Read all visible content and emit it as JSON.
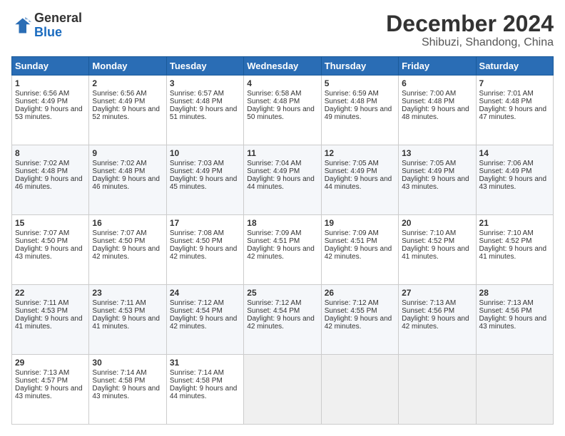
{
  "logo": {
    "general": "General",
    "blue": "Blue"
  },
  "header": {
    "month": "December 2024",
    "location": "Shibuzi, Shandong, China"
  },
  "weekdays": [
    "Sunday",
    "Monday",
    "Tuesday",
    "Wednesday",
    "Thursday",
    "Friday",
    "Saturday"
  ],
  "weeks": [
    [
      {
        "day": "1",
        "sunrise": "6:56 AM",
        "sunset": "4:49 PM",
        "daylight": "9 hours and 53 minutes."
      },
      {
        "day": "2",
        "sunrise": "6:56 AM",
        "sunset": "4:49 PM",
        "daylight": "9 hours and 52 minutes."
      },
      {
        "day": "3",
        "sunrise": "6:57 AM",
        "sunset": "4:48 PM",
        "daylight": "9 hours and 51 minutes."
      },
      {
        "day": "4",
        "sunrise": "6:58 AM",
        "sunset": "4:48 PM",
        "daylight": "9 hours and 50 minutes."
      },
      {
        "day": "5",
        "sunrise": "6:59 AM",
        "sunset": "4:48 PM",
        "daylight": "9 hours and 49 minutes."
      },
      {
        "day": "6",
        "sunrise": "7:00 AM",
        "sunset": "4:48 PM",
        "daylight": "9 hours and 48 minutes."
      },
      {
        "day": "7",
        "sunrise": "7:01 AM",
        "sunset": "4:48 PM",
        "daylight": "9 hours and 47 minutes."
      }
    ],
    [
      {
        "day": "8",
        "sunrise": "7:02 AM",
        "sunset": "4:48 PM",
        "daylight": "9 hours and 46 minutes."
      },
      {
        "day": "9",
        "sunrise": "7:02 AM",
        "sunset": "4:48 PM",
        "daylight": "9 hours and 46 minutes."
      },
      {
        "day": "10",
        "sunrise": "7:03 AM",
        "sunset": "4:49 PM",
        "daylight": "9 hours and 45 minutes."
      },
      {
        "day": "11",
        "sunrise": "7:04 AM",
        "sunset": "4:49 PM",
        "daylight": "9 hours and 44 minutes."
      },
      {
        "day": "12",
        "sunrise": "7:05 AM",
        "sunset": "4:49 PM",
        "daylight": "9 hours and 44 minutes."
      },
      {
        "day": "13",
        "sunrise": "7:05 AM",
        "sunset": "4:49 PM",
        "daylight": "9 hours and 43 minutes."
      },
      {
        "day": "14",
        "sunrise": "7:06 AM",
        "sunset": "4:49 PM",
        "daylight": "9 hours and 43 minutes."
      }
    ],
    [
      {
        "day": "15",
        "sunrise": "7:07 AM",
        "sunset": "4:50 PM",
        "daylight": "9 hours and 43 minutes."
      },
      {
        "day": "16",
        "sunrise": "7:07 AM",
        "sunset": "4:50 PM",
        "daylight": "9 hours and 42 minutes."
      },
      {
        "day": "17",
        "sunrise": "7:08 AM",
        "sunset": "4:50 PM",
        "daylight": "9 hours and 42 minutes."
      },
      {
        "day": "18",
        "sunrise": "7:09 AM",
        "sunset": "4:51 PM",
        "daylight": "9 hours and 42 minutes."
      },
      {
        "day": "19",
        "sunrise": "7:09 AM",
        "sunset": "4:51 PM",
        "daylight": "9 hours and 42 minutes."
      },
      {
        "day": "20",
        "sunrise": "7:10 AM",
        "sunset": "4:52 PM",
        "daylight": "9 hours and 41 minutes."
      },
      {
        "day": "21",
        "sunrise": "7:10 AM",
        "sunset": "4:52 PM",
        "daylight": "9 hours and 41 minutes."
      }
    ],
    [
      {
        "day": "22",
        "sunrise": "7:11 AM",
        "sunset": "4:53 PM",
        "daylight": "9 hours and 41 minutes."
      },
      {
        "day": "23",
        "sunrise": "7:11 AM",
        "sunset": "4:53 PM",
        "daylight": "9 hours and 41 minutes."
      },
      {
        "day": "24",
        "sunrise": "7:12 AM",
        "sunset": "4:54 PM",
        "daylight": "9 hours and 42 minutes."
      },
      {
        "day": "25",
        "sunrise": "7:12 AM",
        "sunset": "4:54 PM",
        "daylight": "9 hours and 42 minutes."
      },
      {
        "day": "26",
        "sunrise": "7:12 AM",
        "sunset": "4:55 PM",
        "daylight": "9 hours and 42 minutes."
      },
      {
        "day": "27",
        "sunrise": "7:13 AM",
        "sunset": "4:56 PM",
        "daylight": "9 hours and 42 minutes."
      },
      {
        "day": "28",
        "sunrise": "7:13 AM",
        "sunset": "4:56 PM",
        "daylight": "9 hours and 43 minutes."
      }
    ],
    [
      {
        "day": "29",
        "sunrise": "7:13 AM",
        "sunset": "4:57 PM",
        "daylight": "9 hours and 43 minutes."
      },
      {
        "day": "30",
        "sunrise": "7:14 AM",
        "sunset": "4:58 PM",
        "daylight": "9 hours and 43 minutes."
      },
      {
        "day": "31",
        "sunrise": "7:14 AM",
        "sunset": "4:58 PM",
        "daylight": "9 hours and 44 minutes."
      },
      null,
      null,
      null,
      null
    ]
  ]
}
